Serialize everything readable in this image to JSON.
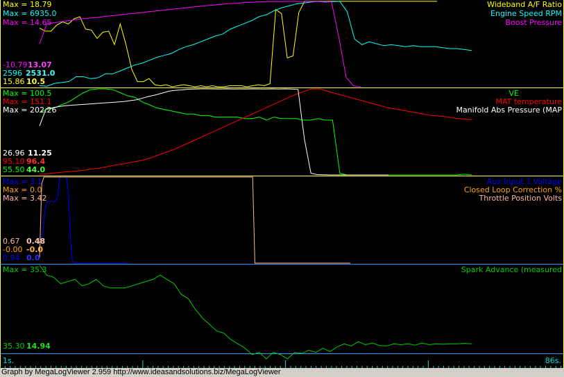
{
  "panels": [
    {
      "id": "p1",
      "series": [
        {
          "name": "Wideband A/F Ratio",
          "color": "#ffff00",
          "max_label": "Max = 18.79",
          "min_label": "15.86",
          "cur_label": "10.5",
          "values": [
            16.2,
            15.9,
            15.9,
            16.5,
            16.8,
            16.6,
            17.1,
            17.3,
            16.1,
            16.0,
            15.2,
            15.8,
            15.9,
            14.6,
            16.6,
            14.6,
            12.2,
            11.0,
            11.0,
            11.3,
            10.7,
            10.6,
            10.7,
            10.5,
            10.6,
            10.7,
            10.6,
            10.5,
            10.6,
            10.5,
            10.6,
            10.5,
            10.5,
            10.6,
            10.6,
            10.6,
            10.5,
            10.6,
            10.7,
            10.6,
            10.8,
            18.0,
            17.6,
            13.3,
            13.5,
            17.7,
            18.8,
            18.8,
            18.8,
            18.8,
            18.8,
            18.8,
            18.8,
            18.8,
            18.8,
            18.8,
            18.8,
            18.8,
            18.8,
            18.8,
            18.8,
            18.8,
            18.8,
            18.8,
            18.8,
            18.8,
            18.8,
            18.8,
            18.8,
            18.8
          ]
        },
        {
          "name": "Engine Speed RPM",
          "color": "#00ffff",
          "max_label": "Max = 6935.0",
          "min_label": "2596",
          "cur_label": "2531.0",
          "values": [
            2590,
            2560,
            2700,
            2750,
            2800,
            3050,
            3050,
            2950,
            3000,
            3200,
            3200,
            3350,
            3500,
            3650,
            3750,
            3900,
            4050,
            4150,
            4250,
            4450,
            4600,
            4700,
            4850,
            5000,
            5150,
            5250,
            5500,
            5650,
            5800,
            5950,
            6150,
            6250,
            6450,
            6600,
            6700,
            6800,
            6850,
            6900,
            6935,
            6900,
            6920,
            6935,
            6400,
            5000,
            4700,
            4850,
            4750,
            4650,
            4700,
            4650,
            4600,
            4650,
            4600,
            4600,
            4600,
            4550,
            4500,
            4500,
            4450,
            4400
          ]
        },
        {
          "name": "Boost Pressure",
          "color": "#ff00ff",
          "max_label": "Max = 14.65",
          "min_label": "-10.79",
          "cur_label": "13.07",
          "values": [
            2.0,
            8.0,
            8.3,
            8.6,
            8.9,
            9.2,
            9.5,
            9.7,
            9.9,
            10.2,
            10.4,
            10.6,
            10.9,
            11.1,
            11.3,
            11.6,
            11.8,
            12.0,
            12.3,
            12.5,
            12.7,
            13.0,
            13.2,
            13.4,
            13.6,
            13.8,
            14.0,
            14.1,
            14.3,
            14.4,
            14.5,
            14.6,
            14.65,
            14.6,
            14.65,
            14.65,
            14.6,
            14.65,
            14.6,
            14.6,
            14.5,
            4.0,
            -8.0,
            -10.5,
            -10.79
          ]
        }
      ]
    },
    {
      "id": "p2",
      "series": [
        {
          "name": "VE",
          "color": "#00ff00",
          "max_label": "Max = 100.5",
          "min_label": "55.50",
          "cur_label": "44.0",
          "values": [
            85,
            87,
            88,
            90,
            92,
            95,
            98,
            100,
            100.5,
            100.5,
            100,
            98,
            96,
            95,
            92,
            90,
            88,
            87,
            86,
            85,
            84,
            84,
            83,
            83,
            82,
            82,
            82,
            82,
            81,
            81,
            82,
            80,
            82,
            81,
            81,
            81,
            80,
            80,
            81,
            80,
            80,
            45,
            44,
            44,
            44,
            44,
            44,
            44,
            44,
            44,
            44,
            44,
            44,
            44,
            44,
            44,
            44,
            44,
            44.5,
            44
          ]
        },
        {
          "name": "MAT temperature",
          "color": "#ff0000",
          "max_label": "Max = 151.1",
          "min_label": "95.10",
          "cur_label": "96.4",
          "values": [
            95.5,
            96.0,
            96.5,
            97.0,
            97.5,
            98.0,
            98.8,
            99.5,
            100.5,
            101.5,
            102.5,
            103.5,
            104.5,
            106,
            108,
            110,
            112,
            114.5,
            117,
            119.5,
            122,
            124.5,
            127,
            129.5,
            132,
            134.5,
            137,
            139.5,
            142,
            144.5,
            147,
            149,
            151,
            151.1,
            149.5,
            148,
            146.5,
            145,
            143.5,
            142,
            140.5,
            139,
            138,
            137,
            136,
            135,
            134,
            133.5,
            133,
            132,
            131.5,
            131
          ]
        },
        {
          "name": "Manifold Abs Pressure (MAP",
          "color": "#ffffff",
          "max_label": "Max = 202.26",
          "min_label": "26.96",
          "cur_label": "11.25",
          "values": [
            120,
            158,
            160,
            163,
            165,
            166,
            167,
            168,
            169,
            170,
            171,
            172,
            173,
            174,
            176,
            178,
            182,
            186,
            189,
            193,
            197,
            199,
            200,
            201.5,
            202,
            202.2,
            202.26,
            202.1,
            202,
            202.2,
            202,
            202.1,
            202,
            202.26,
            202.1,
            202,
            202.2,
            202,
            202.26,
            202,
            201,
            90,
            15,
            12,
            11.5,
            11.3,
            11.2,
            11.2,
            11.25,
            11.2,
            11.3,
            11.2,
            11.25,
            11.2,
            11.25
          ]
        }
      ]
    },
    {
      "id": "p3",
      "series": [
        {
          "name": "Aux Input 1 Voltage",
          "color": "#0000ff",
          "max_label": "Max = 3.1",
          "min_label": "0.94",
          "cur_label": "0.0",
          "values": [
            0.9,
            0.95,
            1.1,
            1.9,
            2.2,
            2.2,
            2.2,
            2.25,
            2.2,
            2.25,
            2.4,
            3.05,
            3.1,
            3.1,
            3.1,
            3.05,
            2.4,
            1.0,
            0.1,
            0.0,
            0.0,
            0.0,
            0.0,
            0.0,
            0.0,
            0.0,
            0.0,
            0.0,
            0.0,
            0.0,
            0.0,
            0.0,
            0.0,
            0.0,
            0.0,
            0.0,
            0.0,
            0.0,
            0.0,
            0.0,
            0.0,
            0.0,
            0.0,
            0.0,
            0.0,
            0.0,
            0.0,
            0.0,
            0.0,
            0.0
          ]
        },
        {
          "name": "Closed Loop Correction %",
          "color": "#ffa500",
          "max_label": "Max = 0.0",
          "min_label": "-0.00",
          "cur_label": "-0.0",
          "values": []
        },
        {
          "name": "Throttle Position Volts",
          "color": "#ffb6a0",
          "max_label": "Max = 3.42",
          "min_label": "0.67",
          "cur_label": "0.48",
          "values": [
            0.67,
            3.2,
            3.42,
            3.42,
            3.42,
            3.42,
            3.42,
            3.42,
            3.42,
            3.42,
            3.42,
            3.42,
            3.42,
            3.42,
            3.42,
            3.42,
            3.42,
            3.42,
            3.42,
            3.42,
            3.42,
            3.42,
            3.42,
            3.42,
            3.42,
            3.42,
            3.42,
            3.42,
            3.42,
            3.42,
            3.42,
            3.42,
            3.42,
            3.42,
            3.42,
            3.42,
            3.42,
            3.42,
            3.42,
            3.42,
            3.42,
            3.42,
            3.42,
            3.42,
            3.42,
            3.42,
            3.42,
            3.42,
            3.42,
            3.42,
            3.42,
            3.42,
            3.42,
            3.42,
            3.42,
            3.42,
            3.42,
            3.42,
            3.42,
            3.42,
            3.42,
            3.42,
            3.42,
            3.42,
            3.42,
            3.42,
            3.42,
            3.42,
            3.42,
            3.42,
            3.42,
            3.42,
            3.42,
            3.42,
            3.42,
            3.42,
            3.42,
            3.42,
            3.42,
            3.42,
            3.42,
            3.42,
            3.42,
            3.42,
            3.42,
            3.42,
            3.42,
            3.42,
            3.42,
            3.42,
            3.42,
            3.42,
            3.42,
            3.42,
            3.42,
            3.42,
            3.42,
            0.48,
            0.48,
            0.48,
            0.48,
            0.48,
            0.48,
            0.48,
            0.48,
            0.48,
            0.48,
            0.48,
            0.48,
            0.48,
            0.48,
            0.48,
            0.48,
            0.48,
            0.48,
            0.48,
            0.48,
            0.48,
            0.48,
            0.48,
            0.48,
            0.48,
            0.48,
            0.48,
            0.48,
            0.48,
            0.48,
            0.48,
            0.48,
            0.48,
            0.48,
            0.48,
            0.48,
            0.48,
            0.48,
            0.48,
            0.48,
            0.48,
            0.48,
            0.48,
            0.48
          ]
        }
      ]
    },
    {
      "id": "p4",
      "series": [
        {
          "name": "Spark Advance (measured",
          "color": "#00cc00",
          "max_label": "Max = 35.3",
          "min_label": "35.30",
          "cur_label": "14.94",
          "values": [
            35.3,
            33,
            32.5,
            31,
            31.5,
            32,
            30.5,
            31,
            32,
            30.5,
            30,
            30,
            30,
            30.5,
            31,
            31.5,
            32,
            33,
            32,
            31,
            28.5,
            27.5,
            25,
            23,
            21.5,
            20,
            19.5,
            18,
            17,
            16,
            14.5,
            15,
            13.5,
            15,
            14.5,
            13.5,
            15,
            14.8,
            15.5,
            15,
            16,
            15.2,
            16.3,
            17,
            16.5,
            17.5,
            16.8,
            17.2,
            16.6,
            16.5,
            17,
            16.8,
            17,
            16.7,
            17.2,
            16.8,
            17,
            16.9,
            17,
            17,
            17.1,
            17
          ]
        }
      ]
    }
  ],
  "time_axis": {
    "start_label": "1s.",
    "end_label": "86s."
  },
  "footer": {
    "text": "Graph by MegaLogViewer 2.959 http://www.ideasandsolutions.biz/MegaLogViewer"
  }
}
